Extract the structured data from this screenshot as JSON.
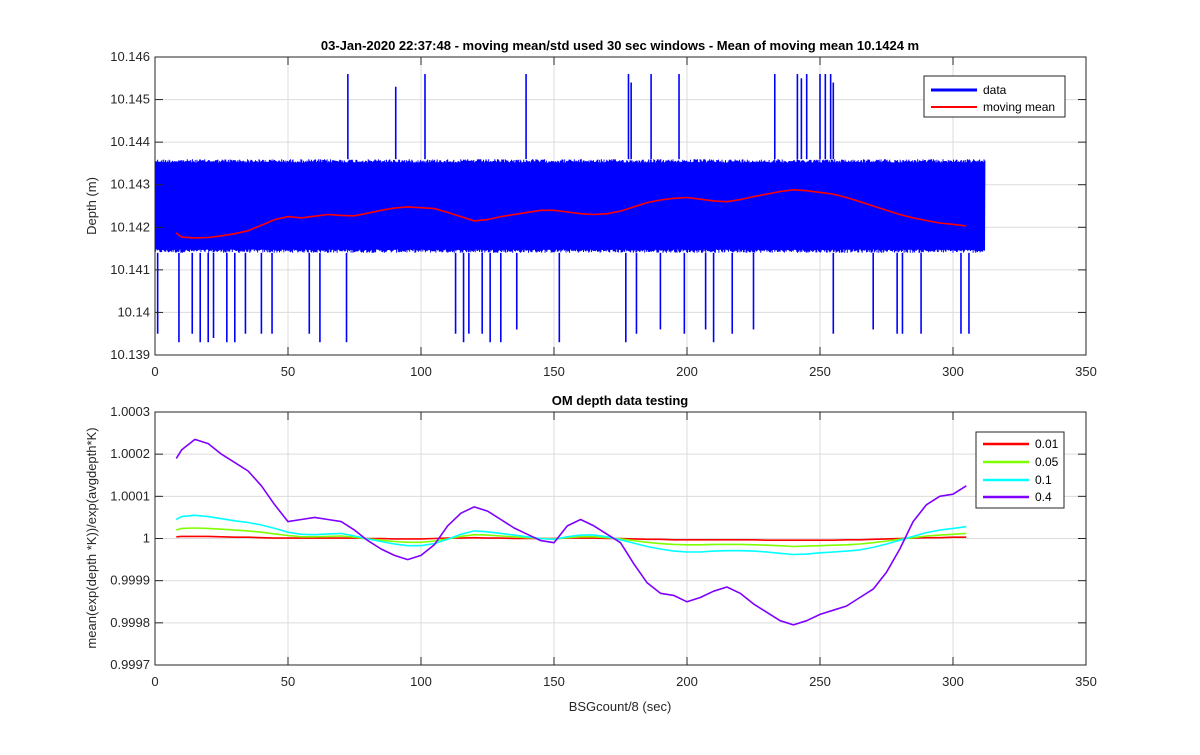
{
  "chart_data": [
    {
      "type": "line",
      "title": "03-Jan-2020 22:37:48 - moving mean/std used 30 sec windows - Mean of moving mean 10.1424 m",
      "xlabel": "",
      "ylabel": "Depth (m)",
      "xlim": [
        0,
        350
      ],
      "ylim": [
        10.139,
        10.146
      ],
      "xticks": [
        "0",
        "50",
        "100",
        "150",
        "200",
        "250",
        "300",
        "350"
      ],
      "yticks": [
        "10.139",
        "10.14",
        "10.141",
        "10.142",
        "10.143",
        "10.144",
        "10.145",
        "10.146"
      ],
      "grid": true,
      "legend_placement": "top-right",
      "series": [
        {
          "name": "data",
          "color": "#0000ff",
          "x_range": [
            0,
            312
          ],
          "band_low": 10.1414,
          "band_high": 10.1436,
          "spikes_high": [
            [
              72.5,
              10.1456
            ],
            [
              90.5,
              10.1453
            ],
            [
              101.5,
              10.1456
            ],
            [
              139.5,
              10.1456
            ],
            [
              178,
              10.1456
            ],
            [
              179,
              10.1454
            ],
            [
              186.5,
              10.1456
            ],
            [
              197,
              10.1456
            ],
            [
              233,
              10.1456
            ],
            [
              241.5,
              10.1456
            ],
            [
              243,
              10.1455
            ],
            [
              245,
              10.1456
            ],
            [
              250,
              10.1456
            ],
            [
              252,
              10.1456
            ],
            [
              254,
              10.1456
            ],
            [
              255,
              10.1454
            ]
          ],
          "spikes_low": [
            [
              1,
              10.1395
            ],
            [
              9,
              10.1393
            ],
            [
              14,
              10.1395
            ],
            [
              17,
              10.1393
            ],
            [
              20,
              10.1393
            ],
            [
              22,
              10.1394
            ],
            [
              27,
              10.1393
            ],
            [
              30,
              10.1393
            ],
            [
              34,
              10.1395
            ],
            [
              40,
              10.1395
            ],
            [
              44,
              10.1395
            ],
            [
              58,
              10.1395
            ],
            [
              62,
              10.1393
            ],
            [
              72,
              10.1393
            ],
            [
              113,
              10.1395
            ],
            [
              116,
              10.1393
            ],
            [
              118,
              10.1395
            ],
            [
              123,
              10.1395
            ],
            [
              126,
              10.1393
            ],
            [
              130,
              10.1393
            ],
            [
              136,
              10.1396
            ],
            [
              152,
              10.1393
            ],
            [
              177,
              10.1393
            ],
            [
              181,
              10.1395
            ],
            [
              190,
              10.1396
            ],
            [
              199,
              10.1395
            ],
            [
              207,
              10.1396
            ],
            [
              210,
              10.1393
            ],
            [
              217,
              10.1395
            ],
            [
              225,
              10.1396
            ],
            [
              255,
              10.1395
            ],
            [
              270,
              10.1396
            ],
            [
              279,
              10.1395
            ],
            [
              281,
              10.1395
            ],
            [
              288,
              10.1395
            ],
            [
              303,
              10.1395
            ],
            [
              306,
              10.1395
            ]
          ]
        },
        {
          "name": "moving mean",
          "color": "#ff0000",
          "x": [
            8,
            10,
            15,
            20,
            25,
            30,
            35,
            40,
            45,
            50,
            55,
            60,
            65,
            70,
            75,
            80,
            85,
            90,
            95,
            100,
            105,
            110,
            115,
            120,
            125,
            130,
            135,
            140,
            145,
            150,
            155,
            160,
            165,
            170,
            175,
            180,
            185,
            190,
            195,
            200,
            205,
            210,
            215,
            220,
            225,
            230,
            235,
            240,
            245,
            250,
            255,
            260,
            265,
            270,
            275,
            280,
            285,
            290,
            295,
            300,
            305
          ],
          "y": [
            10.14187,
            10.14177,
            10.14175,
            10.14176,
            10.1418,
            10.14185,
            10.14192,
            10.14205,
            10.14218,
            10.14225,
            10.14222,
            10.14226,
            10.1423,
            10.14228,
            10.14227,
            10.14233,
            10.1424,
            10.14245,
            10.14248,
            10.14246,
            10.14244,
            10.14235,
            10.14225,
            10.14215,
            10.14218,
            10.14225,
            10.1423,
            10.14235,
            10.1424,
            10.1424,
            10.14236,
            10.14232,
            10.1423,
            10.14232,
            10.14238,
            10.14248,
            10.14258,
            10.14264,
            10.14268,
            10.1427,
            10.14266,
            10.14262,
            10.1426,
            10.14265,
            10.14272,
            10.14278,
            10.14284,
            10.14288,
            10.14286,
            10.14282,
            10.14278,
            10.1427,
            10.1426,
            10.1425,
            10.1424,
            10.1423,
            10.14222,
            10.14216,
            10.1421,
            10.14207,
            10.14203
          ]
        }
      ]
    },
    {
      "type": "line",
      "title": "OM depth data testing",
      "xlabel": "BSGcount/8 (sec)",
      "ylabel": "mean(exp(depth *K))/exp(avgdepth*K)",
      "xlim": [
        0,
        350
      ],
      "ylim": [
        0.9997,
        1.0003
      ],
      "xticks": [
        "0",
        "50",
        "100",
        "150",
        "200",
        "250",
        "300",
        "350"
      ],
      "yticks": [
        "0.9997",
        "0.9998",
        "0.9999",
        "1",
        "1.0001",
        "1.0002",
        "1.0003"
      ],
      "grid": true,
      "legend_placement": "top-right",
      "x": [
        8,
        10,
        15,
        20,
        25,
        30,
        35,
        40,
        45,
        50,
        55,
        60,
        65,
        70,
        75,
        80,
        85,
        90,
        95,
        100,
        105,
        110,
        115,
        120,
        125,
        130,
        135,
        140,
        145,
        150,
        155,
        160,
        165,
        170,
        175,
        180,
        185,
        190,
        195,
        200,
        205,
        210,
        215,
        220,
        225,
        230,
        235,
        240,
        245,
        250,
        255,
        260,
        265,
        270,
        275,
        280,
        285,
        290,
        295,
        300,
        305
      ],
      "series": [
        {
          "name": "0.01",
          "color": "#ff0000",
          "values": [
            1.000004,
            1.000005,
            1.000005,
            1.000005,
            1.000004,
            1.000003,
            1.000003,
            1.000002,
            1.000001,
            1.000001,
            1.000001,
            1.000001,
            1.000001,
            1.000001,
            1.000001,
            1.0,
            1.0,
            0.999999,
            0.999999,
            0.999999,
            1.0,
            1.000001,
            1.000001,
            1.000002,
            1.000001,
            1.000001,
            1.0,
            1.0,
            1.0,
            1.0,
            1.000001,
            1.000001,
            1.000001,
            1.0,
            1.0,
            0.999999,
            0.999998,
            0.999998,
            0.999997,
            0.999997,
            0.999997,
            0.999997,
            0.999997,
            0.999997,
            0.999997,
            0.999996,
            0.999996,
            0.999996,
            0.999996,
            0.999996,
            0.999996,
            0.999997,
            0.999997,
            0.999998,
            0.999999,
            1.0,
            1.000001,
            1.000002,
            1.000002,
            1.000003,
            1.000003
          ]
        },
        {
          "name": "0.05",
          "color": "#80ff00",
          "values": [
            1.00002,
            1.000024,
            1.000025,
            1.000024,
            1.000022,
            1.00002,
            1.000018,
            1.000015,
            1.000011,
            1.000007,
            1.000004,
            1.000004,
            1.000005,
            1.000006,
            1.000003,
            0.999999,
            0.999996,
            0.999993,
            0.999991,
            0.999991,
            0.999994,
            0.999999,
            1.000005,
            1.000009,
            1.000008,
            1.000006,
            1.000004,
            1.000002,
            1.0,
            0.999999,
            1.000002,
            1.000004,
            1.000004,
            1.000002,
            0.999999,
            0.999995,
            0.999991,
            0.999988,
            0.999986,
            0.999985,
            0.999985,
            0.999986,
            0.999986,
            0.999986,
            0.999985,
            0.999984,
            0.999983,
            0.999981,
            0.999982,
            0.999983,
            0.999984,
            0.999985,
            0.999987,
            0.99999,
            0.999994,
            0.999998,
            1.000002,
            1.000006,
            1.000008,
            1.00001,
            1.000012
          ]
        },
        {
          "name": "0.1",
          "color": "#00ffff",
          "values": [
            1.000045,
            1.000052,
            1.000055,
            1.000052,
            1.000047,
            1.000042,
            1.000038,
            1.000032,
            1.000024,
            1.000015,
            1.00001,
            1.000009,
            1.000011,
            1.000012,
            1.000006,
            0.999999,
            0.999993,
            0.999987,
            0.999983,
            0.999983,
            0.999988,
            0.999998,
            1.00001,
            1.000018,
            1.000016,
            1.000012,
            1.000008,
            1.000004,
            1.0,
            0.999998,
            1.000004,
            1.000008,
            1.000008,
            1.000004,
            0.999997,
            0.999989,
            0.999981,
            0.999975,
            0.99997,
            0.999968,
            0.999968,
            0.99997,
            0.999971,
            0.999971,
            0.99997,
            0.999968,
            0.999965,
            0.999962,
            0.999963,
            0.999966,
            0.999968,
            0.99997,
            0.999973,
            0.999979,
            0.999987,
            0.999996,
            1.000005,
            1.000014,
            1.00002,
            1.000024,
            1.000028
          ]
        },
        {
          "name": "0.4",
          "color": "#7f00ff",
          "values": [
            1.00019,
            1.00021,
            1.000235,
            1.000225,
            1.0002,
            1.00018,
            1.00016,
            1.000125,
            1.00008,
            1.00004,
            1.000045,
            1.00005,
            1.000045,
            1.00004,
            1.00002,
            0.999995,
            0.999975,
            0.99996,
            0.99995,
            0.99996,
            0.999985,
            1.00003,
            1.00006,
            1.000075,
            1.000065,
            1.000045,
            1.000025,
            1.00001,
            0.999995,
            0.99999,
            1.00003,
            1.000045,
            1.00003,
            1.00001,
            0.99999,
            0.99994,
            0.999895,
            0.99987,
            0.999865,
            0.99985,
            0.99986,
            0.999875,
            0.999885,
            0.99987,
            0.999845,
            0.999825,
            0.999805,
            0.999795,
            0.999805,
            0.99982,
            0.99983,
            0.99984,
            0.99986,
            0.99988,
            0.99992,
            0.999975,
            1.00004,
            1.00008,
            1.0001,
            1.000105,
            1.000125
          ]
        }
      ]
    }
  ]
}
